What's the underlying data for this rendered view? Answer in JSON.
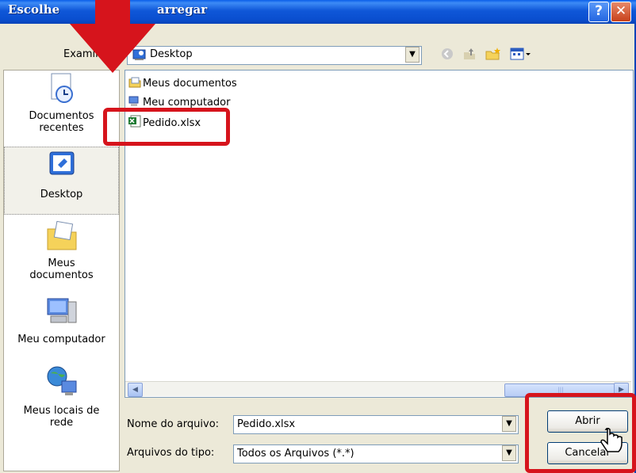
{
  "dialog": {
    "title_left": "Escolhe",
    "title_right": "arregar",
    "help_label": "?",
    "close_label": "✕"
  },
  "toolbar": {
    "look_in_label": "Examin",
    "look_in_value": "Desktop",
    "icons": [
      "back-icon",
      "up-folder-icon",
      "new-folder-icon",
      "view-menu-icon"
    ]
  },
  "places": [
    {
      "label_line1": "Documentos",
      "label_line2": "recentes",
      "icon": "recent-documents-icon"
    },
    {
      "label_line1": "Desktop",
      "label_line2": "",
      "icon": "desktop-icon"
    },
    {
      "label_line1": "Meus",
      "label_line2": "documentos",
      "icon": "my-documents-icon"
    },
    {
      "label_line1": "Meu computador",
      "label_line2": "",
      "icon": "my-computer-icon"
    },
    {
      "label_line1": "Meus locais de",
      "label_line2": "rede",
      "icon": "network-places-icon"
    }
  ],
  "files": [
    {
      "name": "Meus documentos",
      "icon": "folder-icon"
    },
    {
      "name": "Meu computador",
      "icon": "computer-icon"
    },
    {
      "name": "Pedido.xlsx",
      "icon": "excel-file-icon"
    }
  ],
  "form": {
    "filename_label": "Nome do arquivo:",
    "filename_value": "Pedido.xlsx",
    "filetype_label": "Arquivos do tipo:",
    "filetype_value": "Todos os Arquivos (*.*)",
    "open_button": "Abrir",
    "cancel_button": "Cancelar"
  },
  "colors": {
    "titlebar": "#0a4fd0",
    "annotation_red": "#d6141c"
  }
}
